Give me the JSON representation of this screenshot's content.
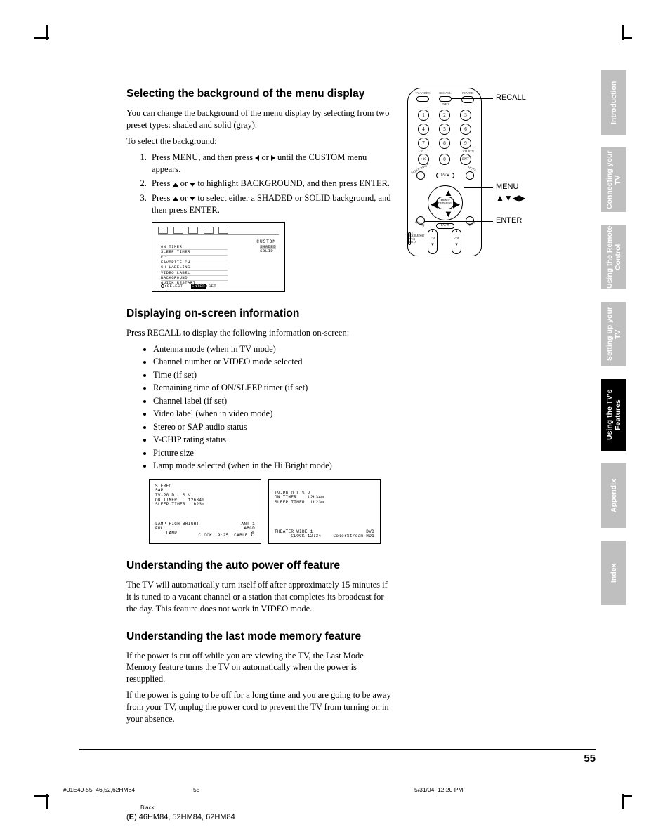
{
  "sections": {
    "s1": {
      "heading": "Selecting the background of the menu display",
      "p1": "You can change the background of the menu display by selecting from two preset types: shaded and solid (gray).",
      "p2": "To select the background:",
      "li1a": "Press MENU, and then press ",
      "li1b": " or ",
      "li1c": " until the CUSTOM menu appears.",
      "li2a": "Press ",
      "li2b": " or ",
      "li2c": " to highlight BACKGROUND, and then press ENTER.",
      "li3a": "Press ",
      "li3b": " or ",
      "li3c": " to select either a SHADED or SOLID background, and then press ENTER."
    },
    "s2": {
      "heading": "Displaying on-screen information",
      "p1": "Press RECALL to display the following information on-screen:",
      "b1": "Antenna mode (when in TV mode)",
      "b2": "Channel number or VIDEO mode selected",
      "b3": "Time (if set)",
      "b4": "Remaining time of ON/SLEEP timer (if set)",
      "b5": "Channel label (if set)",
      "b6": "Video label (when in video mode)",
      "b7": "Stereo or SAP audio status",
      "b8": "V-CHIP rating status",
      "b9": "Picture size",
      "b10": "Lamp mode selected (when in the Hi Bright mode)"
    },
    "s3": {
      "heading": "Understanding the auto power off feature",
      "p1": "The TV will automatically turn itself off after approximately 15 minutes if it is tuned to a vacant channel or a station that completes its broadcast for the day. This feature does not work in VIDEO mode."
    },
    "s4": {
      "heading": "Understanding the last mode memory feature",
      "p1": "If the power is cut off while you are viewing the TV, the Last Mode Memory feature turns the TV on automatically when the power is resupplied.",
      "p2": "If the power is going to be off for a long time and you are going to be away from your TV, unplug the power cord to prevent the TV from turning on in your absence."
    }
  },
  "menu_box": {
    "title": "CUSTOM",
    "items": [
      "ON TIMER",
      "SLEEP TIMER",
      "CC",
      "FAVORITE CH",
      "CH LABELING",
      "VIDEO LABEL",
      "BACKGROUND",
      "QUICK RESTART"
    ],
    "opts": [
      "SHADED",
      "SOLID"
    ],
    "footer_select": ":SELECT",
    "footer_enter": "ENTER",
    "footer_set": ":SET"
  },
  "osd1": {
    "l1": "STEREO",
    "l2": "SAP",
    "l3": "TV-PG D L S V",
    "l4": "ON TIMER    12h34m",
    "l5": "SLEEP TIMER  1h23m",
    "b1": "LAMP HIGH BRIGHT",
    "b2r": "ANT 1",
    "b3": "FULL",
    "b3r": "ABCD",
    "b4": "    LAMP",
    "b4b": "CLOCK  9:25",
    "b4c": "CABLE",
    "b4d": "6"
  },
  "osd2": {
    "l1": "TV-PG D L S V",
    "l2": "ON TIMER    12h34m",
    "l3": "SLEEP TIMER  1h23m",
    "b1": "THEATER WIDE 1",
    "b1r": "DVD",
    "b2": "      CLOCK 12:34",
    "b2r": "ColorStream HD1"
  },
  "remote": {
    "top": {
      "tvvideo": "TV/VIDEO",
      "recall": "RECALL",
      "power": "POWER",
      "info": "INFO"
    },
    "nums": [
      "1",
      "2",
      "3",
      "4",
      "5",
      "6",
      "7",
      "8",
      "9",
      "+10",
      "0",
      "ENT"
    ],
    "row_labels": {
      "plus10": "+10",
      "chrtn": "CH RTN"
    },
    "midrow": {
      "left": "SLEEP INPUT",
      "favup": "FAV▲",
      "right": "MUTE"
    },
    "dpad": "MENU/ DVDMENU",
    "lowrow": {
      "left": "ENTER",
      "favdn": "FAV▼",
      "right": "EXIT"
    },
    "side": {
      "tv": "TV",
      "cablesat": "CABLE/SAT",
      "vcr": "VCR",
      "dvd": "DVD"
    },
    "rockers": {
      "ch": "CH",
      "vol": "VOL"
    }
  },
  "callouts": {
    "recall": "RECALL",
    "menu": "MENU",
    "arrows": "▲▼◀▶",
    "enter": "ENTER"
  },
  "tabs": [
    "Introduction",
    "Connecting your TV",
    "Using the Remote Control",
    "Setting up your TV",
    "Using the TV's Features",
    "Appendix",
    "Index"
  ],
  "page_number": "55",
  "footer": {
    "file": "#01E49-55_46,52,62HM84",
    "pg": "55",
    "date": "5/31/04, 12:20 PM",
    "black": "Black",
    "model_e": "E",
    "model_rest": ") 46HM84, 52HM84, 62HM84"
  }
}
